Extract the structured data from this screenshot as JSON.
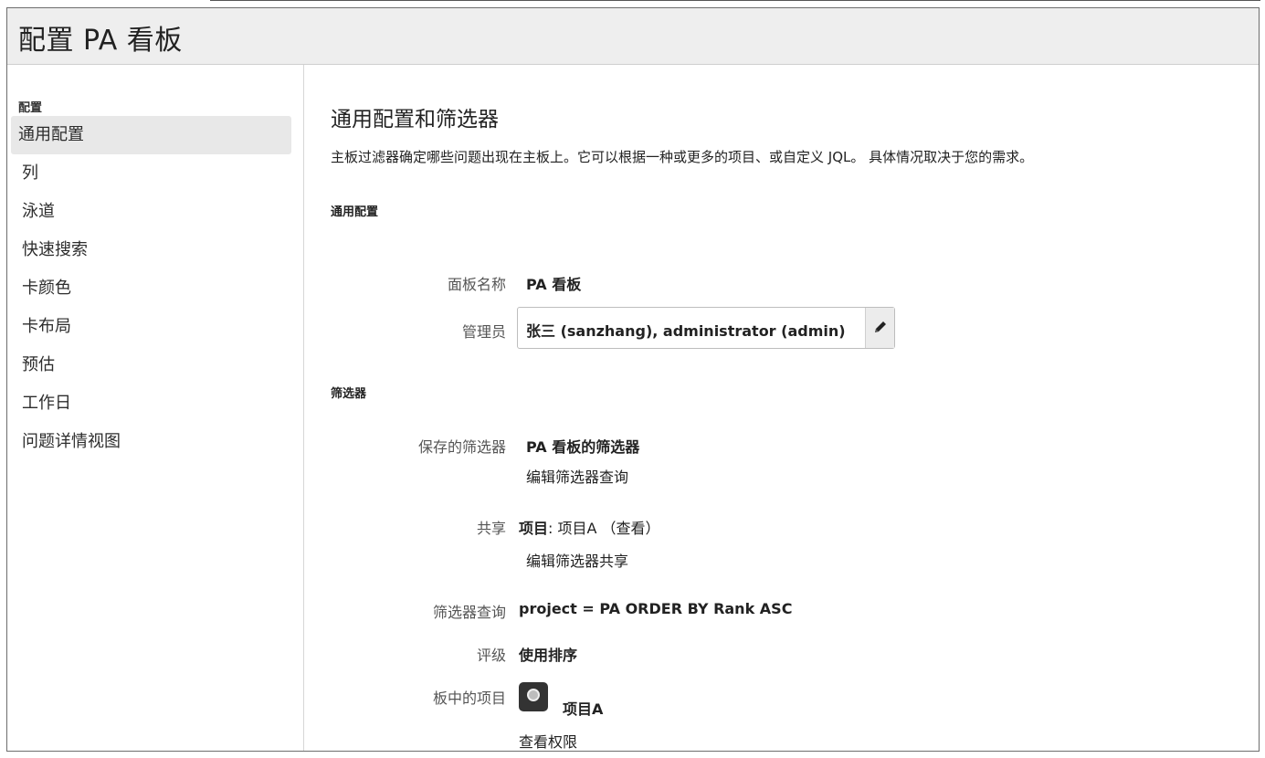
{
  "header": {
    "title": "配置 PA 看板"
  },
  "sidebar": {
    "section_label": "配置",
    "items": [
      {
        "label": "通用配置",
        "active": true
      },
      {
        "label": "列"
      },
      {
        "label": "泳道"
      },
      {
        "label": "快速搜索"
      },
      {
        "label": "卡颜色"
      },
      {
        "label": "卡布局"
      },
      {
        "label": "预估"
      },
      {
        "label": "工作日"
      },
      {
        "label": "问题详情视图"
      }
    ]
  },
  "main": {
    "title": "通用配置和筛选器",
    "description": "主板过滤器确定哪些问题出现在主板上。它可以根据一种或更多的项目、或自定义 JQL。 具体情况取决于您的需求。",
    "general": {
      "heading": "通用配置",
      "board_name_label": "面板名称",
      "board_name_value": "PA 看板",
      "admin_label": "管理员",
      "admin_value": "张三 (sanzhang), administrator (admin)",
      "admin_edit_icon": "pencil-icon"
    },
    "filter": {
      "heading": "筛选器",
      "saved_filter_label": "保存的筛选器",
      "saved_filter_value": "PA 看板的筛选器",
      "edit_query_link": "编辑筛选器查询",
      "share_label": "共享",
      "share_key": "项目",
      "share_value": ": 项目A （查看）",
      "edit_share_link": "编辑筛选器共享",
      "query_label": "筛选器查询",
      "query_value": "project = PA ORDER BY Rank ASC",
      "rank_label": "评级",
      "rank_value": "使用排序",
      "projects_label": "板中的项目",
      "project_name": "项目A",
      "project_icon": "project-avatar-icon",
      "view_permissions_link": "查看权限"
    }
  }
}
